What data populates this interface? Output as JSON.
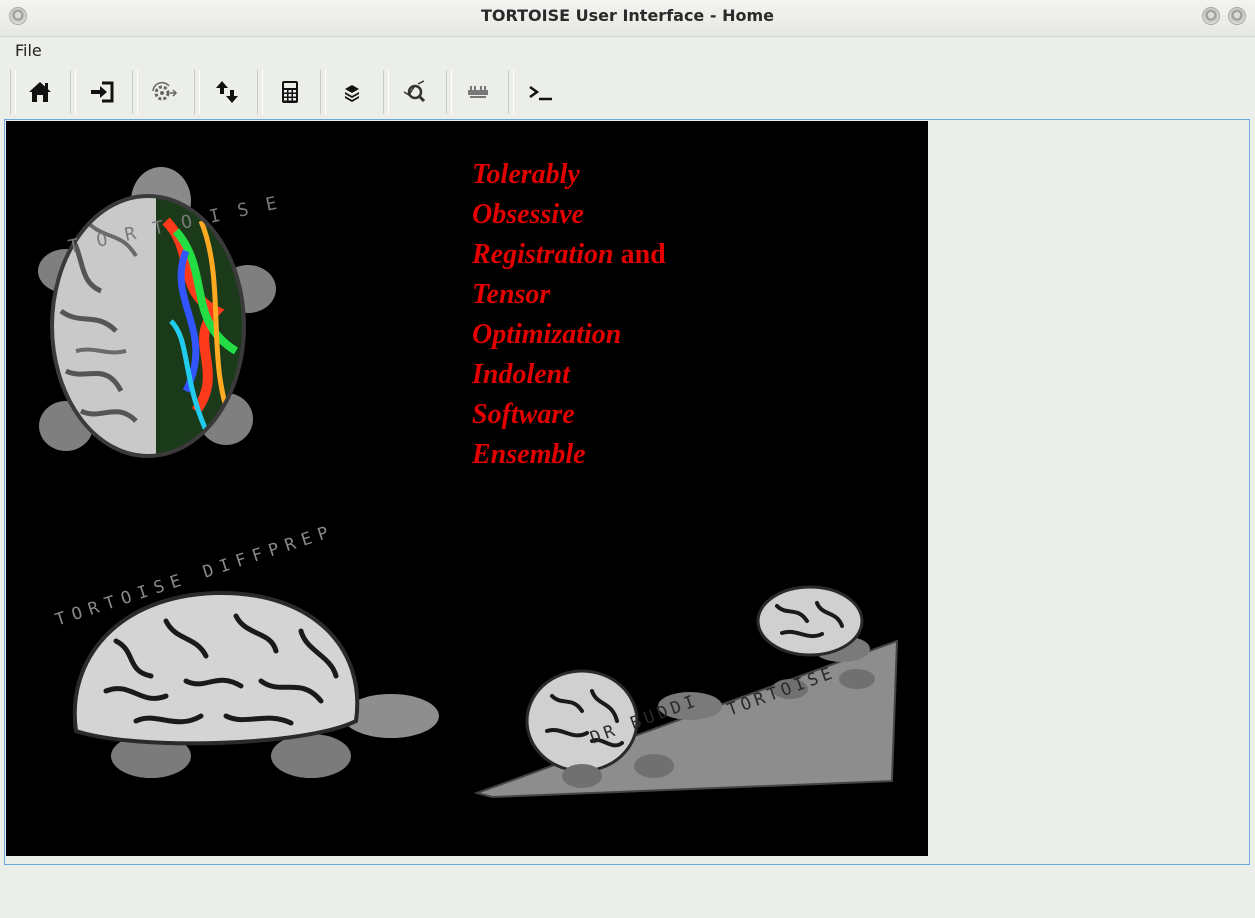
{
  "window": {
    "title": "TORTOISE User Interface - Home"
  },
  "menu": {
    "file_label": "File"
  },
  "toolbar": {
    "buttons": [
      {
        "icon": "home-icon"
      },
      {
        "icon": "import-icon"
      },
      {
        "icon": "process-settings-icon"
      },
      {
        "icon": "upload-download-icon"
      },
      {
        "icon": "calculator-icon"
      },
      {
        "icon": "layers-icon"
      },
      {
        "icon": "analyze-icon"
      },
      {
        "icon": "pipeline-icon"
      },
      {
        "icon": "terminal-icon"
      }
    ]
  },
  "splash": {
    "acronym": [
      {
        "text": "Tolerably",
        "plain": ""
      },
      {
        "text": "Obsessive",
        "plain": ""
      },
      {
        "text": "Registration",
        "plain": " and"
      },
      {
        "text": "Tensor",
        "plain": ""
      },
      {
        "text": "Optimization",
        "plain": ""
      },
      {
        "text": "Indolent",
        "plain": ""
      },
      {
        "text": "Software",
        "plain": ""
      },
      {
        "text": "Ensemble",
        "plain": ""
      }
    ],
    "art_labels": {
      "top_turtle": "TORTOISE",
      "brain_turtle": "TORTOISE DIFFPREP",
      "slope_left": "DR BUDDI",
      "slope_right": "TORTOISE"
    },
    "colors": {
      "background": "#000000",
      "text": "#e30000"
    }
  }
}
